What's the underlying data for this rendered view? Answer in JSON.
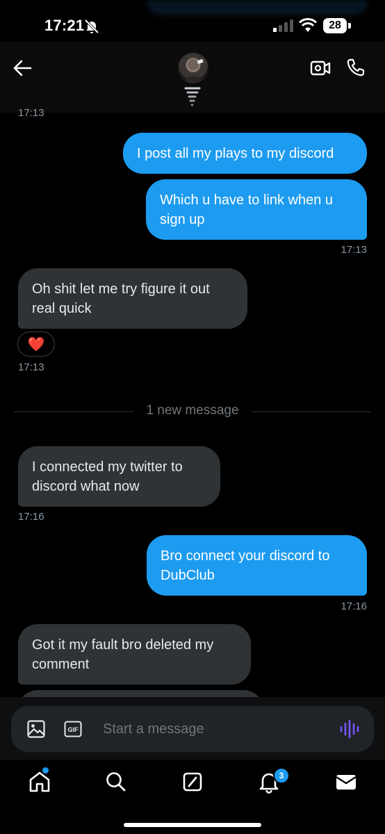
{
  "status_bar": {
    "time": "17:21",
    "battery": "28"
  },
  "header": {
    "back_label": "Back",
    "video_label": "Video call",
    "phone_label": "Voice call"
  },
  "timeline": {
    "cut_timestamp": "17:13",
    "messages": [
      {
        "direction": "outgoing",
        "text": "I post all my plays to my discord"
      },
      {
        "direction": "outgoing",
        "text": "Which u have to link when u sign up",
        "timestamp": "17:13"
      },
      {
        "direction": "incoming",
        "text": "Oh shit let me try figure it out real quick",
        "reaction": "❤️",
        "timestamp": "17:13"
      },
      {
        "direction": "incoming",
        "text": "I connected my twitter to discord what now",
        "timestamp": "17:16"
      },
      {
        "direction": "outgoing",
        "text": "Bro connect your discord to DubClub",
        "timestamp": "17:16"
      },
      {
        "direction": "incoming",
        "text": "Got it my fault bro deleted my comment"
      }
    ],
    "new_message_divider": "1 new message"
  },
  "composer": {
    "placeholder": "Start a message",
    "gif_label": "GIF"
  },
  "tabbar": {
    "items": [
      {
        "name": "home",
        "icon": "home-icon",
        "has_dot": true
      },
      {
        "name": "search",
        "icon": "search-icon"
      },
      {
        "name": "compose",
        "icon": "compose-icon"
      },
      {
        "name": "notifications",
        "icon": "bell-icon",
        "badge": "3"
      },
      {
        "name": "messages",
        "icon": "mail-icon"
      }
    ]
  },
  "colors": {
    "accent": "#1d9bf0",
    "incoming_bubble": "#2f3336",
    "background": "#000000"
  }
}
